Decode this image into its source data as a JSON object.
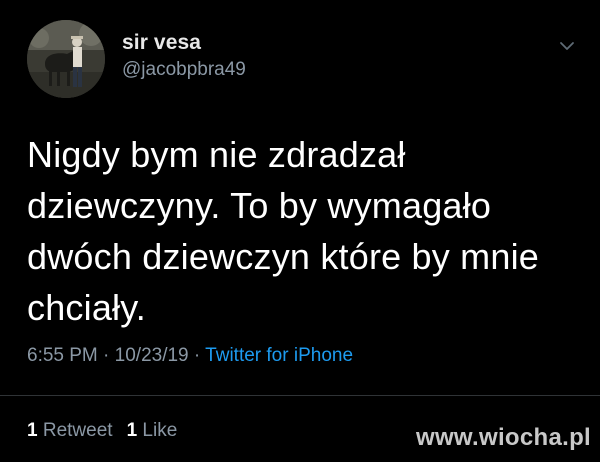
{
  "author": {
    "display_name": "sir vesa",
    "handle": "@jacobpbra49",
    "avatar_icon": "profile-photo-icon"
  },
  "menu": {
    "icon": "chevron-down-icon"
  },
  "tweet": {
    "text": "Nigdy bym nie zdradzał dziewczyny. To by wymagało dwóch dziewczyn które by mnie chciały.",
    "time": "6:55 PM",
    "date": "10/23/19",
    "separator": "·",
    "source": "Twitter for iPhone"
  },
  "stats": {
    "retweet_count": "1",
    "retweet_label": "Retweet",
    "like_count": "1",
    "like_label": "Like"
  },
  "watermark": {
    "text": "www.wiocha.pl"
  },
  "colors": {
    "background": "#000000",
    "primary_text": "#ffffff",
    "secondary_text": "#8b98a5",
    "link": "#1d9bf0",
    "divider": "#2f3336"
  }
}
